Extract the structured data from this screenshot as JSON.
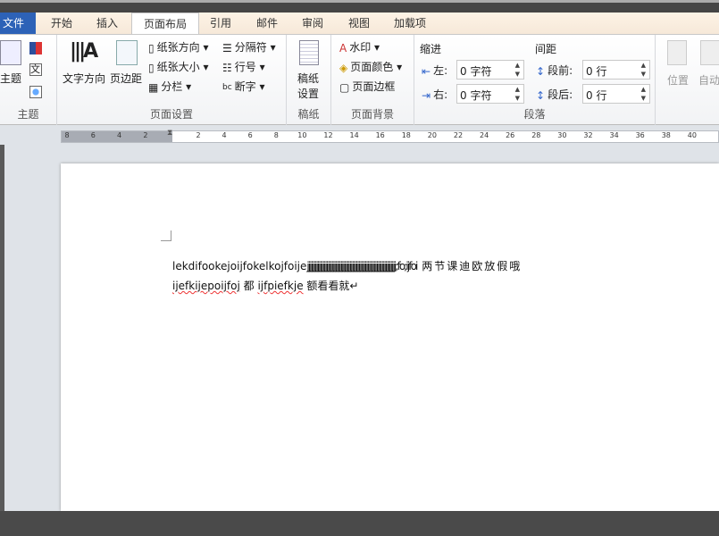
{
  "tabs": [
    "文件",
    "开始",
    "插入",
    "页面布局",
    "引用",
    "邮件",
    "审阅",
    "视图",
    "加载项"
  ],
  "groups": {
    "theme": {
      "label": "主题",
      "button": "主题"
    },
    "page_setup": {
      "label": "页面设置",
      "text_direction": "文字方向",
      "margins": "页边距",
      "orientation": "纸张方向",
      "size": "纸张大小",
      "columns": "分栏",
      "breaks": "分隔符",
      "line_numbers": "行号",
      "hyphenation": "断字"
    },
    "manuscript": {
      "label": "稿纸",
      "button_line1": "稿纸",
      "button_line2": "设置"
    },
    "page_background": {
      "label": "页面背景",
      "watermark": "水印",
      "page_color": "页面颜色",
      "page_borders": "页面边框"
    },
    "paragraph": {
      "label": "段落",
      "indent_title": "缩进",
      "left_label": "左:",
      "left_value": "0 字符",
      "right_label": "右:",
      "right_value": "0 字符",
      "spacing_title": "间距",
      "before_label": "段前:",
      "before_value": "0 行",
      "after_label": "段后:",
      "after_value": "0 行"
    },
    "arrange": {
      "position": "位置",
      "auto": "自动"
    }
  },
  "ruler": [
    "8",
    "6",
    "4",
    "2",
    "2",
    "4",
    "6",
    "8",
    "10",
    "12",
    "14",
    "16",
    "18",
    "20",
    "22",
    "24",
    "26",
    "28",
    "30",
    "32",
    "34",
    "36",
    "38",
    "40"
  ],
  "document": {
    "line1_a": "lekdifookejoijfokelkojfoije",
    "line1_b": "jjjjjjjjjjjjjjjjjjjjjjjjjjjjjjjjjjjjjjjjjjjjjjjjjjjjjjjjjjjjjjjjjjjjj;fo;ijfoi",
    "line1_c": " 两节课迪欧放假哦",
    "line2_a": "ijefkijepoijfoj",
    "line2_b": " 都 ",
    "line2_c": "ijfpiefkje",
    "line2_d": " 额看看就↵"
  }
}
